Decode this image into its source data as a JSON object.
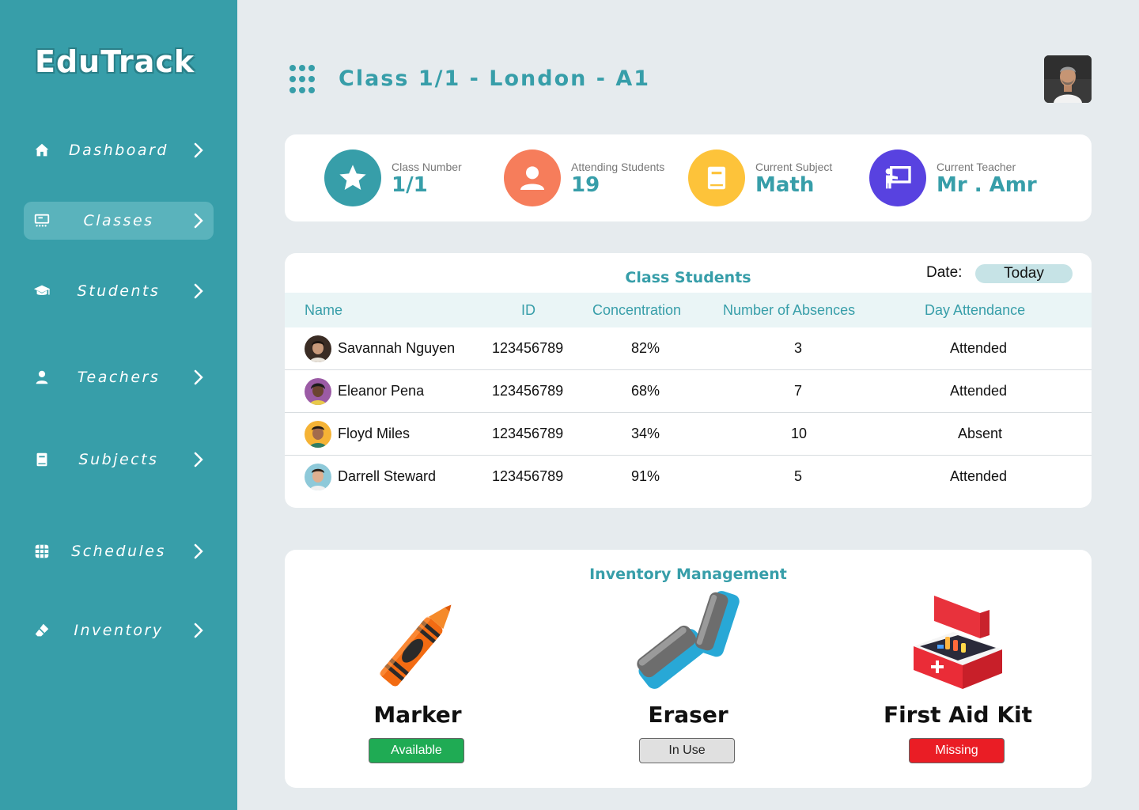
{
  "app": {
    "name": "EduTrack"
  },
  "sidebar": {
    "items": [
      {
        "label": "Dashboard",
        "icon": "home-icon"
      },
      {
        "label": "Classes",
        "icon": "class-board-icon",
        "active": true
      },
      {
        "label": "Students",
        "icon": "graduation-cap-icon"
      },
      {
        "label": "Teachers",
        "icon": "person-icon"
      },
      {
        "label": "Subjects",
        "icon": "book-icon"
      },
      {
        "label": "Schedules",
        "icon": "calendar-grid-icon"
      },
      {
        "label": "Inventory",
        "icon": "eraser-icon"
      }
    ]
  },
  "header": {
    "title": "Class 1/1 - London - A1"
  },
  "stats": [
    {
      "label": "Class Number",
      "value": "1/1",
      "icon": "star-icon",
      "color": "#379ea9"
    },
    {
      "label": "Attending Students",
      "value": "19",
      "icon": "person-icon",
      "color": "#f67d5b"
    },
    {
      "label": "Current Subject",
      "value": "Math",
      "icon": "book-icon",
      "color": "#fdc33a"
    },
    {
      "label": "Current Teacher",
      "value": "Mr . Amr",
      "icon": "teacher-board-icon",
      "color": "#5842e0"
    }
  ],
  "students": {
    "title": "Class Students",
    "date_label": "Date:",
    "date_value": "Today",
    "columns": [
      "Name",
      "ID",
      "Concentration",
      "Number of Absences",
      "Day Attendance"
    ],
    "rows": [
      {
        "name": "Savannah Nguyen",
        "id": "123456789",
        "concentration": "82%",
        "absences": "3",
        "attendance": "Attended",
        "avatar_color": "#3a2c24"
      },
      {
        "name": "Eleanor Pena",
        "id": "123456789",
        "concentration": "68%",
        "absences": "7",
        "attendance": "Attended",
        "avatar_color": "#9b5ba5"
      },
      {
        "name": "Floyd Miles",
        "id": "123456789",
        "concentration": "34%",
        "absences": "10",
        "attendance": "Absent",
        "avatar_color": "#f5b335"
      },
      {
        "name": "Darrell Steward",
        "id": "123456789",
        "concentration": "91%",
        "absences": "5",
        "attendance": "Attended",
        "avatar_color": "#8ec9d9"
      }
    ]
  },
  "inventory": {
    "title": "Inventory Management",
    "items": [
      {
        "name": "Marker",
        "status": "Available",
        "status_color": "#1fab54",
        "status_text_color": "#ffffff"
      },
      {
        "name": "Eraser",
        "status": "In Use",
        "status_color": "#e0e0e0",
        "status_text_color": "#222222"
      },
      {
        "name": "First Aid Kit",
        "status": "Missing",
        "status_color": "#ea1d25",
        "status_text_color": "#ffffff"
      }
    ]
  },
  "colors": {
    "accent": "#379ea9",
    "background": "#e6ebee",
    "card": "#ffffff"
  }
}
